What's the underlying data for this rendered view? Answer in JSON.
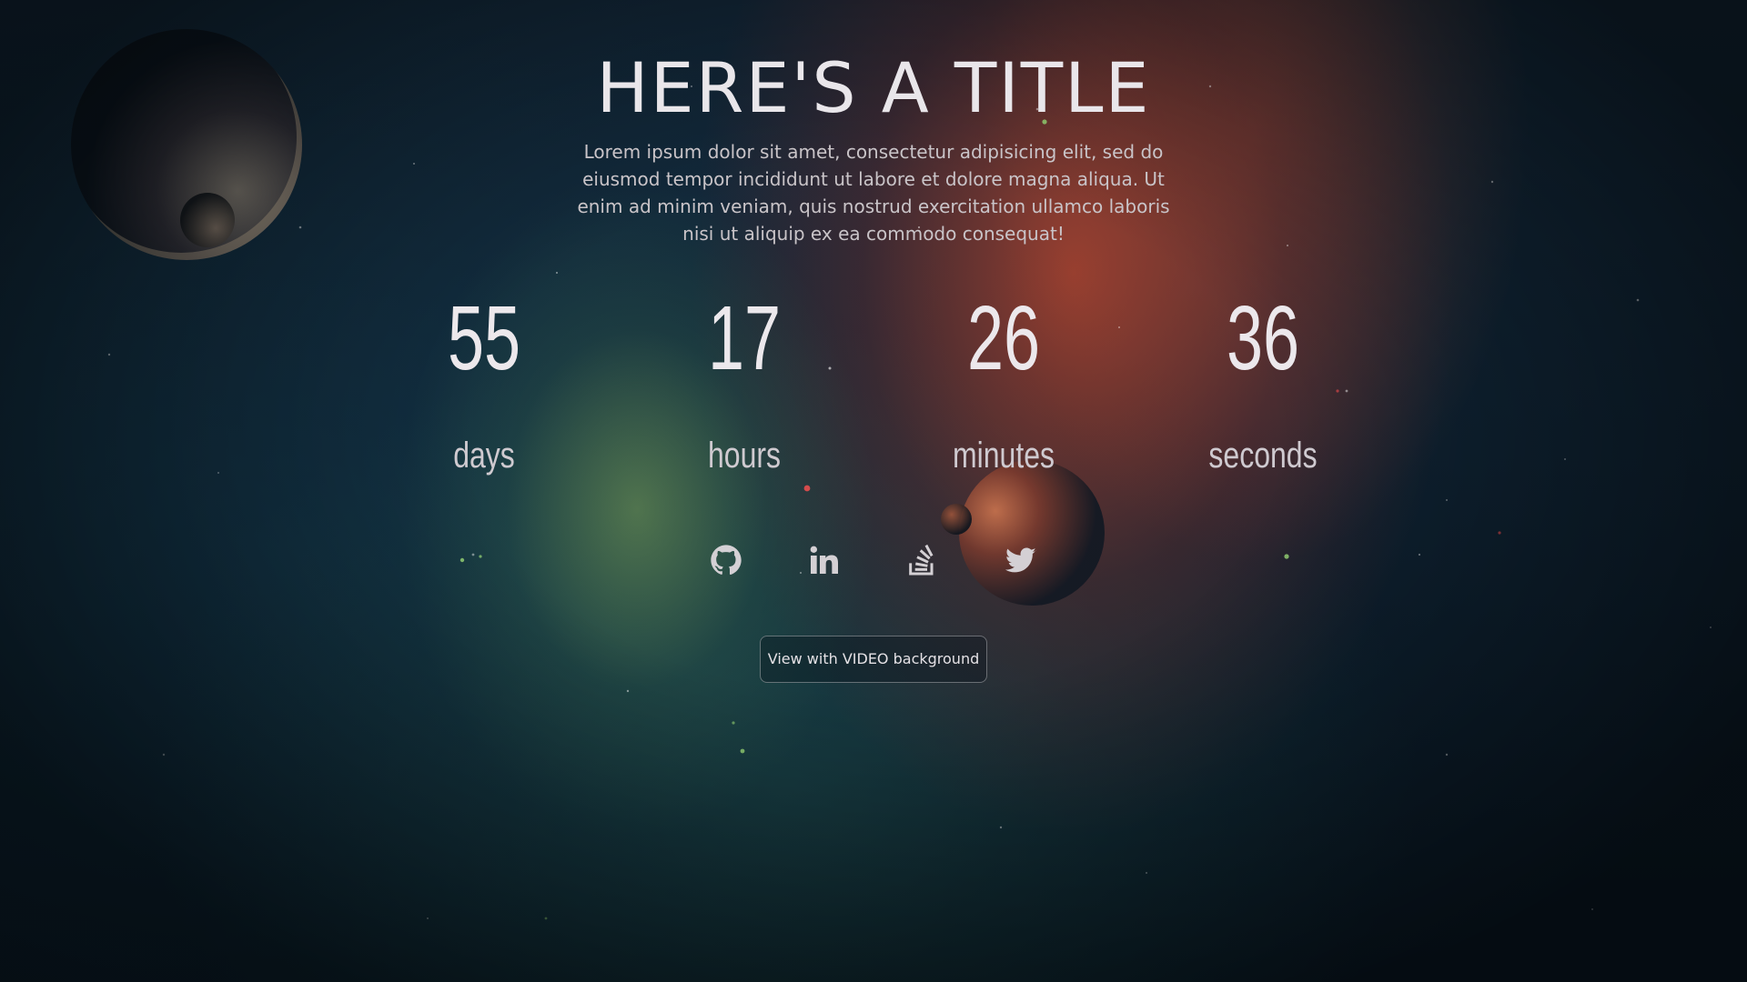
{
  "hero": {
    "title": "HERE'S A TITLE",
    "description": "Lorem ipsum dolor sit amet, consectetur adipisicing elit, sed do eiusmod tempor incididunt ut labore et dolore magna aliqua. Ut enim ad minim veniam, quis nostrud exercitation ullamco laboris nisi ut aliquip ex ea commodo consequat!"
  },
  "countdown": {
    "days": {
      "value": "55",
      "label": "days"
    },
    "hours": {
      "value": "17",
      "label": "hours"
    },
    "minutes": {
      "value": "26",
      "label": "minutes"
    },
    "seconds": {
      "value": "36",
      "label": "seconds"
    }
  },
  "social": {
    "icons": [
      "github-icon",
      "linkedin-icon",
      "stackoverflow-icon",
      "twitter-icon"
    ],
    "icon_color": "#d4d0d4"
  },
  "video_button": {
    "label": "View with VIDEO background"
  },
  "colors": {
    "text_primary": "#ece8ec",
    "nebula_red": "#be462d",
    "nebula_green": "#82aa5a",
    "background_dark": "#0b1a26"
  }
}
